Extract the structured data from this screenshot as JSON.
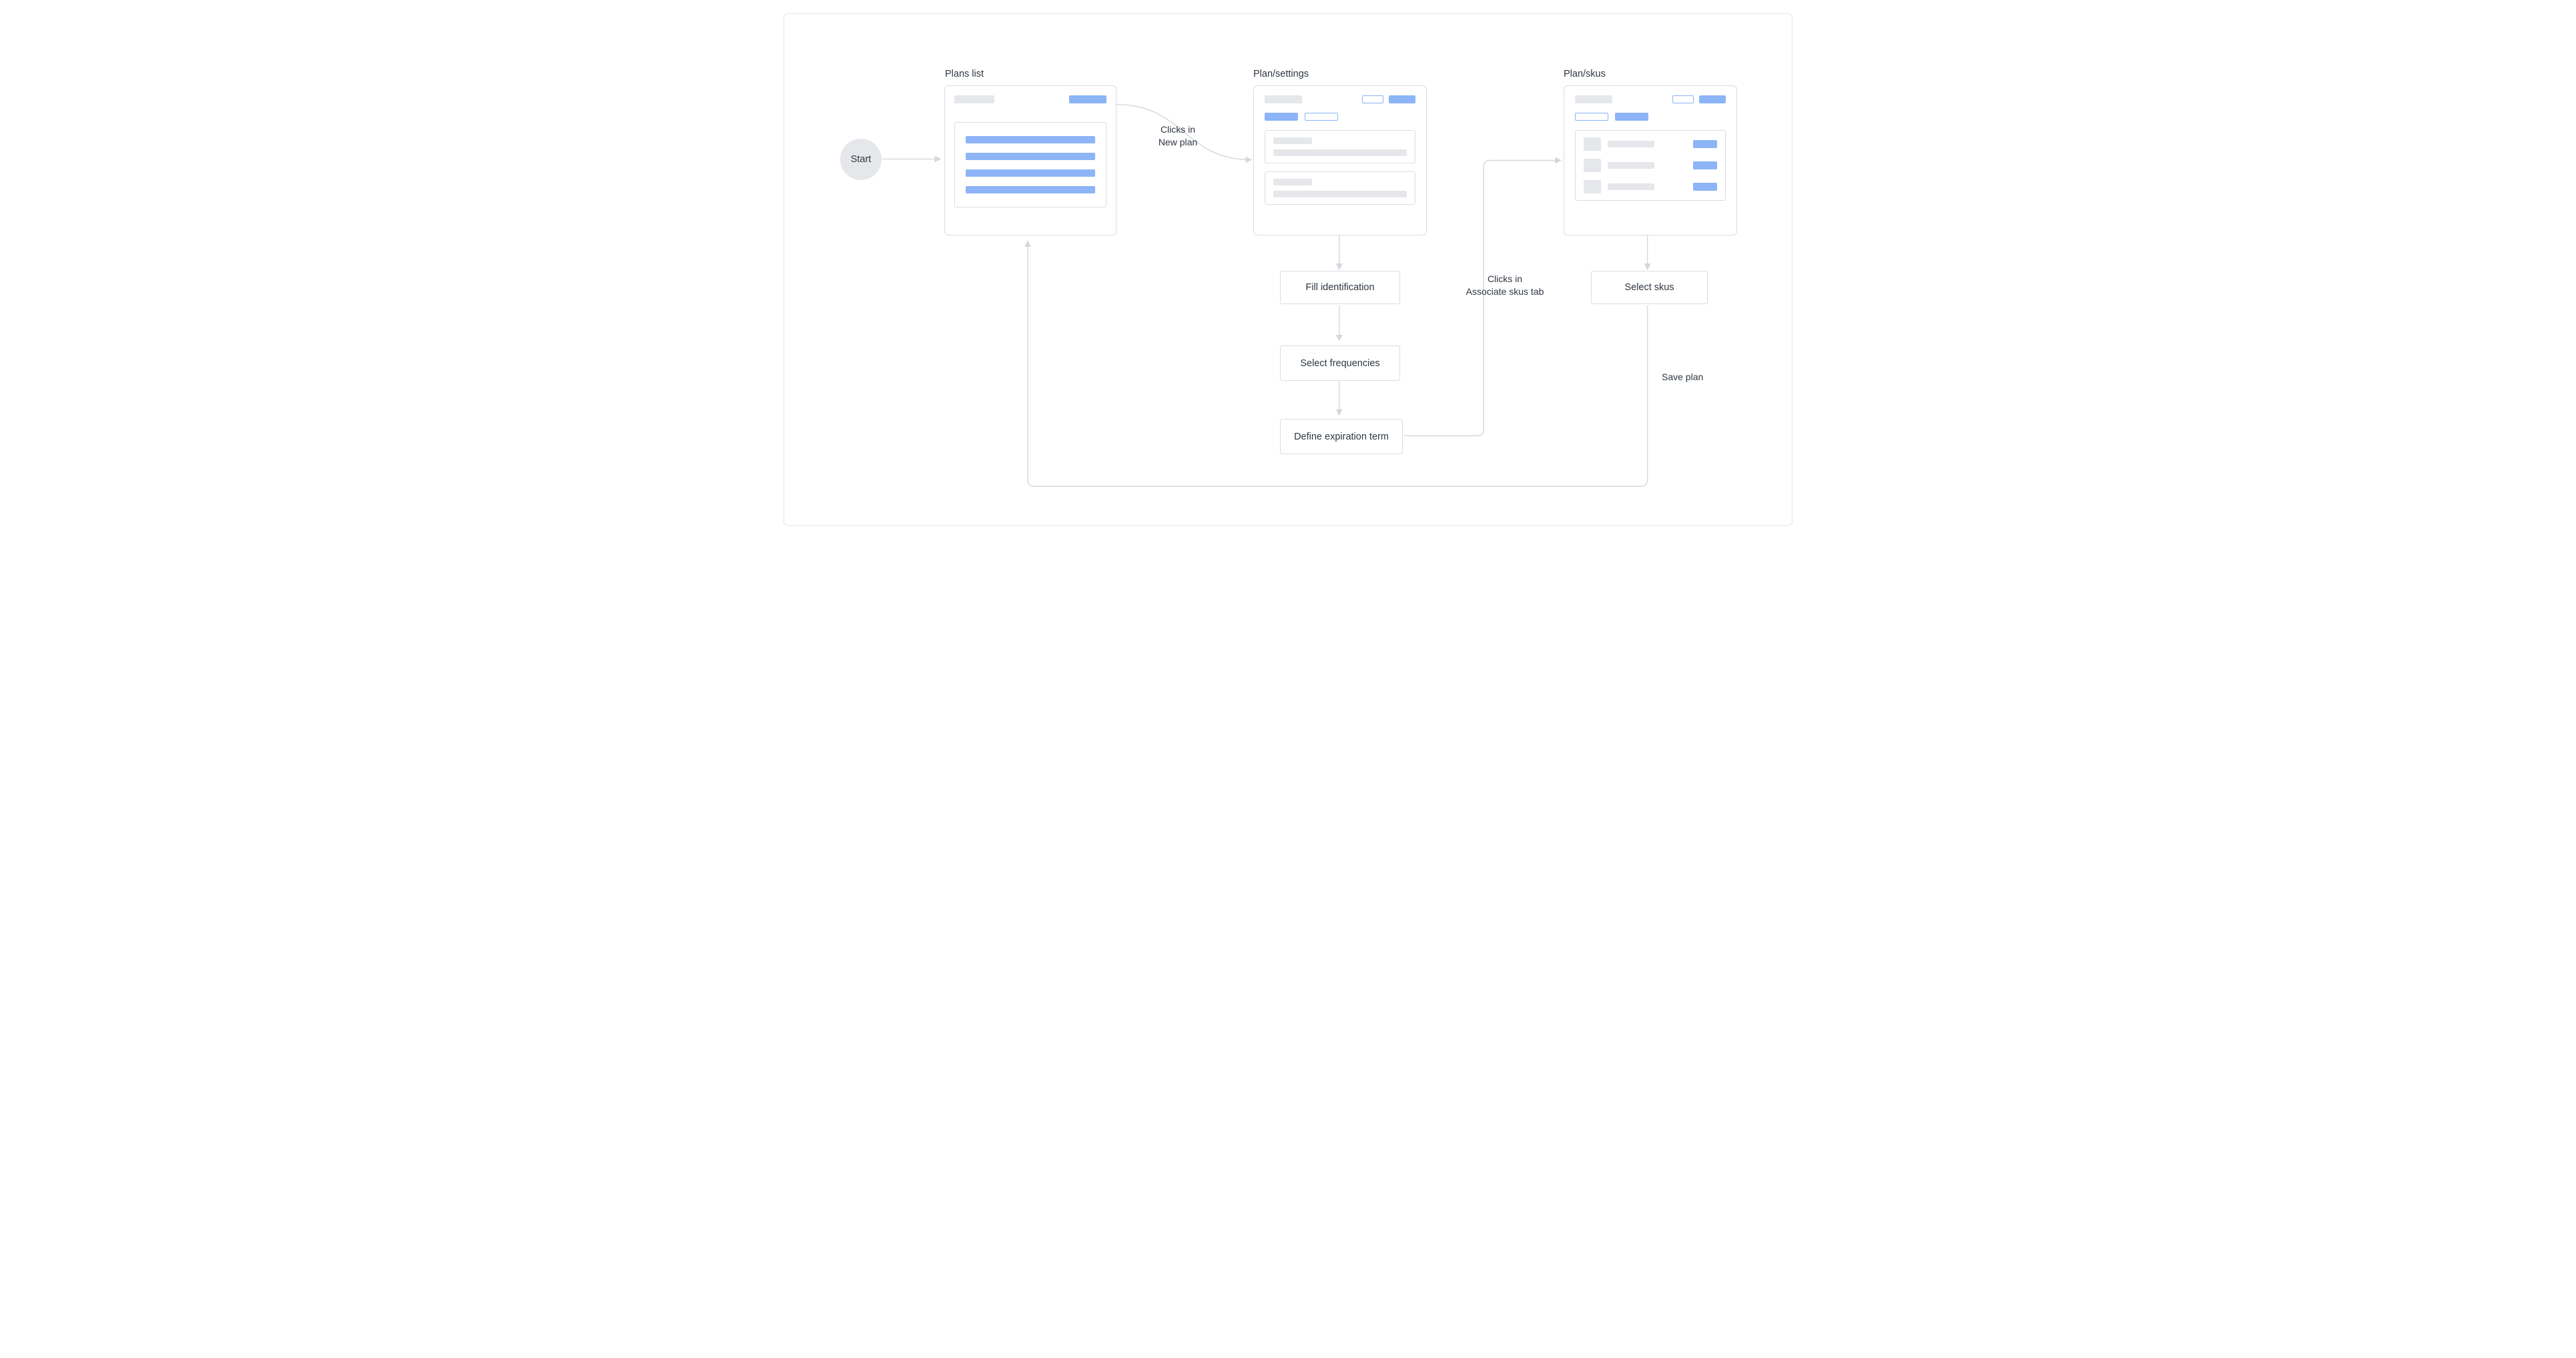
{
  "start": {
    "label": "Start"
  },
  "columns": {
    "plans_list": {
      "title": "Plans list"
    },
    "plan_settings": {
      "title": "Plan/settings"
    },
    "plan_skus": {
      "title": "Plan/skus"
    }
  },
  "steps": {
    "fill_identification": {
      "label": "Fill identification"
    },
    "select_frequencies": {
      "label": "Select frequencies"
    },
    "define_expiration": {
      "label": "Define expiration term"
    },
    "select_skus": {
      "label": "Select skus"
    }
  },
  "edges": {
    "clicks_new_plan": {
      "line1": "Clicks in",
      "line2": "New plan"
    },
    "clicks_assoc_tab": {
      "line1": "Clicks in",
      "line2": "Associate skus tab"
    },
    "save_plan": {
      "label": "Save plan"
    }
  }
}
